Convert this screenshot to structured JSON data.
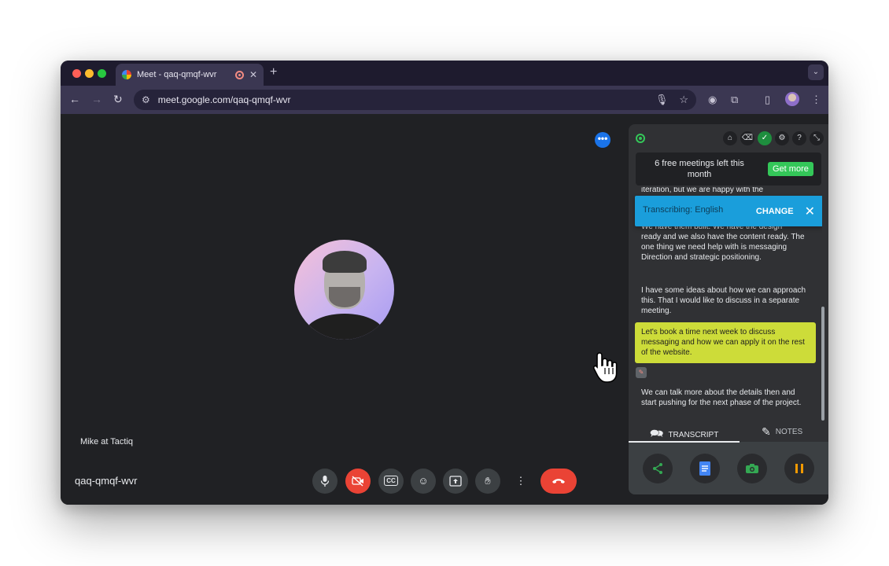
{
  "browser": {
    "tab_title": "Meet - qaq-qmqf-wvr",
    "tab_close": "✕",
    "new_tab": "+",
    "url": "meet.google.com/qaq-qmqf-wvr"
  },
  "meet": {
    "participant_name": "Mike at Tactiq",
    "meeting_code": "qaq-qmqf-wvr",
    "more_dots": "•••",
    "controls": [
      "mic-icon",
      "camera-off-icon",
      "captions-icon",
      "emoji-icon",
      "present-icon",
      "raise-hand-icon",
      "more-options-icon",
      "hang-up-icon"
    ],
    "captions_label": "CC"
  },
  "tactiq": {
    "promo_text": "6 free meetings left this month",
    "get_more": "Get more",
    "banner_text": "Transcribing: English",
    "banner_change": "CHANGE",
    "transcript_clipped_top": "iteration, but we are happy with the",
    "transcript_clipped_second": "We have them built. We have the design",
    "transcript_para1": "ready and we also have the content ready. The one thing we need help with is messaging Direction and strategic positioning.",
    "transcript_para2": "I have some ideas about how we can approach this. That I would like to discuss in a separate meeting.",
    "transcript_highlight": "Let's book a time next week to discuss messaging and how we can apply it on the rest of the website.",
    "transcript_para3": "We can talk more about the details then and start pushing for the next phase of the project.",
    "tab_transcript": "TRANSCRIPT",
    "tab_notes": "NOTES",
    "header_icons": [
      "home-icon",
      "eraser-icon",
      "shield-icon",
      "gear-icon",
      "help-icon",
      "collapse-icon"
    ],
    "action_icons": [
      "share-icon",
      "document-icon",
      "camera-icon",
      "pause-icon"
    ],
    "colors": {
      "highlight": "#cddc39",
      "banner": "#1a9edb",
      "get_more": "#34c759"
    }
  }
}
